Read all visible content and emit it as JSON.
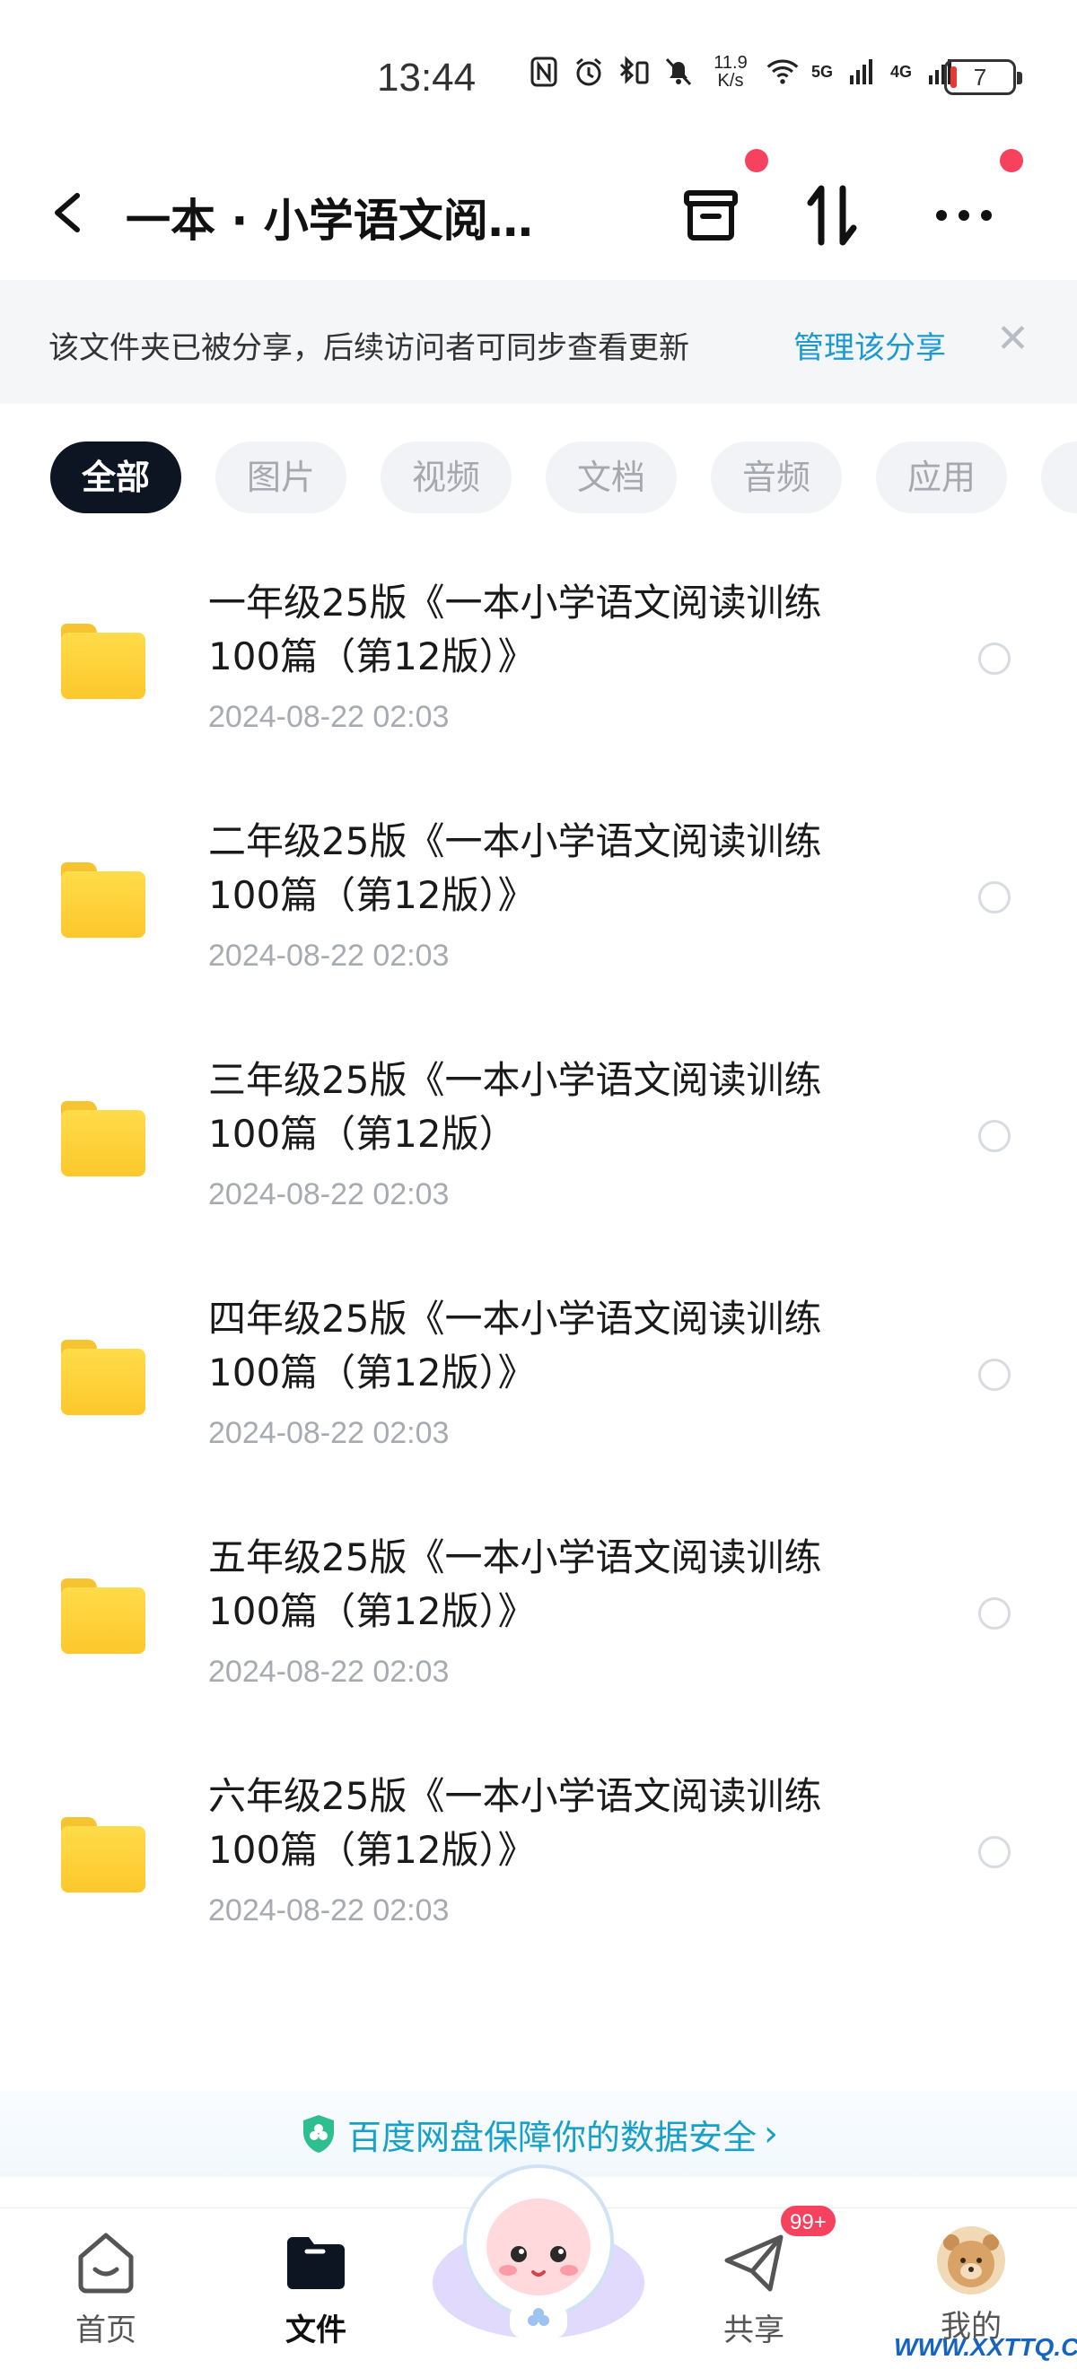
{
  "status_bar": {
    "time": "13:44",
    "net_speed_value": "11.9",
    "net_speed_unit": "K/s",
    "signal_5g": "5G",
    "signal_4g": "4G",
    "battery_level": "7"
  },
  "header": {
    "title": "一本 · 小学语文阅…"
  },
  "notice": {
    "text": "该文件夹已被分享，后续访问者可同步查看更新",
    "link": "管理该分享",
    "close": "✕"
  },
  "filters": [
    {
      "label": "全部",
      "active": true
    },
    {
      "label": "图片",
      "active": false
    },
    {
      "label": "视频",
      "active": false
    },
    {
      "label": "文档",
      "active": false
    },
    {
      "label": "音频",
      "active": false
    },
    {
      "label": "应用",
      "active": false
    },
    {
      "label": "",
      "active": false
    }
  ],
  "files": [
    {
      "name": "一年级25版《一本小学语文阅读训练100篇（第12版）》",
      "date": "2024-08-22  02:03"
    },
    {
      "name": "二年级25版《一本小学语文阅读训练100篇（第12版）》",
      "date": "2024-08-22  02:03"
    },
    {
      "name": "三年级25版《一本小学语文阅读训练100篇（第12版）",
      "date": "2024-08-22  02:03"
    },
    {
      "name": "四年级25版《一本小学语文阅读训练100篇（第12版）》",
      "date": "2024-08-22  02:03"
    },
    {
      "name": "五年级25版《一本小学语文阅读训练100篇（第12版）》",
      "date": "2024-08-22  02:03"
    },
    {
      "name": "六年级25版《一本小学语文阅读训练100篇（第12版）》",
      "date": "2024-08-22  02:03"
    }
  ],
  "security": {
    "text": "百度网盘保障你的数据安全",
    "chevron": "›"
  },
  "bottom_nav": {
    "home": "首页",
    "files": "文件",
    "share": "共享",
    "share_badge": "99+",
    "mine": "我的"
  },
  "watermark": "WWW.XXTTQ.COM",
  "colors": {
    "accent_link": "#1c9ad6",
    "active_chip": "#0d1422",
    "folder": "#fcc82c",
    "badge": "#f7425f"
  }
}
